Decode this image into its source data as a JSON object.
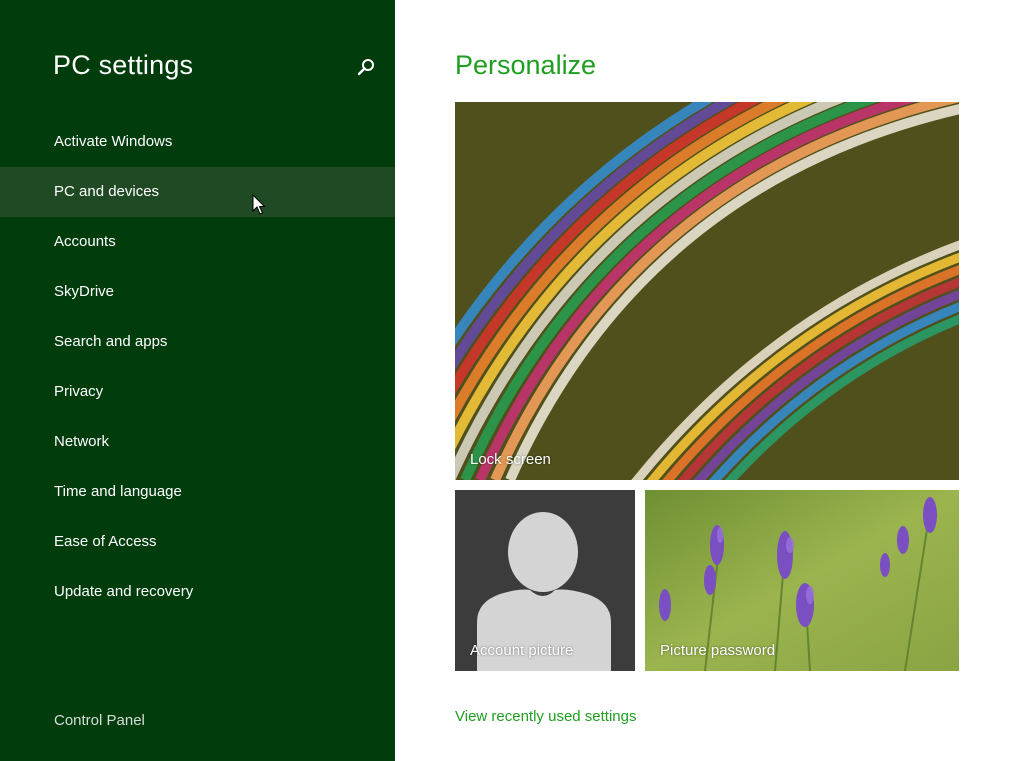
{
  "sidebar": {
    "title": "PC settings",
    "search_icon": "search-icon",
    "items": [
      {
        "label": "Activate Windows"
      },
      {
        "label": "PC and devices"
      },
      {
        "label": "Accounts"
      },
      {
        "label": "SkyDrive"
      },
      {
        "label": "Search and apps"
      },
      {
        "label": "Privacy"
      },
      {
        "label": "Network"
      },
      {
        "label": "Time and language"
      },
      {
        "label": "Ease of Access"
      },
      {
        "label": "Update and recovery"
      }
    ],
    "footer_link": "Control Panel"
  },
  "main": {
    "title": "Personalize",
    "tiles": {
      "lock_screen": "Lock screen",
      "account_picture": "Account picture",
      "picture_password": "Picture password"
    },
    "recent_link": "View recently used settings"
  },
  "colors": {
    "sidebar_bg": "#013c0c",
    "sidebar_hover": "#1f4a23",
    "accent": "#1f9e1f"
  }
}
